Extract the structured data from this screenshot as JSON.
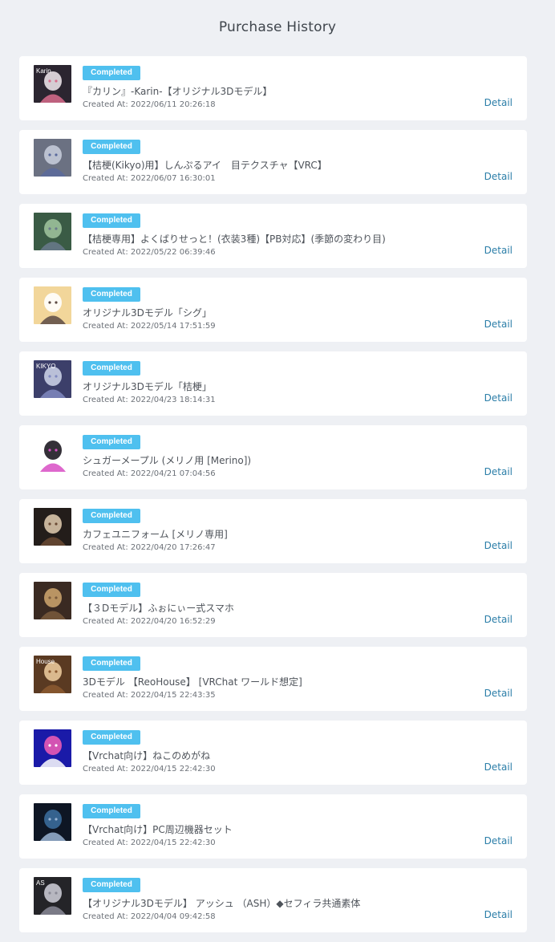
{
  "page": {
    "title": "Purchase History"
  },
  "purchases": [
    {
      "status": "Completed",
      "title": "『カリン』-Karin-【オリジナル3Dモデル】",
      "created": "Created At: 2022/06/11 20:26:18",
      "detail": "Detail",
      "thumb_text": "Karin",
      "thumb_icon": "karin-avatar-thumbnail",
      "colors": [
        "#2b2530",
        "#e8e0e6",
        "#d86c8c"
      ]
    },
    {
      "status": "Completed",
      "title": "【桔梗(Kikyo)用】しんぷるアイ　目テクスチャ【VRC】",
      "created": "Created At: 2022/06/07 16:30:01",
      "detail": "Detail",
      "thumb_text": "",
      "thumb_icon": "eye-texture-thumbnail",
      "colors": [
        "#6b7182",
        "#c4cad8",
        "#5a6a9c"
      ]
    },
    {
      "status": "Completed",
      "title": "【桔梗専用】よくばりせっと！(衣装3種)【PB対応】(季節の変わり目)",
      "created": "Created At: 2022/05/22 06:39:46",
      "detail": "Detail",
      "thumb_text": "",
      "thumb_icon": "outfit-set-thumbnail",
      "colors": [
        "#3a5b45",
        "#9cc09a",
        "#6a7a8c"
      ]
    },
    {
      "status": "Completed",
      "title": "オリジナル3Dモデル「シグ」",
      "created": "Created At: 2022/05/14 17:51:59",
      "detail": "Detail",
      "thumb_text": "",
      "thumb_icon": "sig-model-thumbnail",
      "colors": [
        "#f2d69a",
        "#ffffff",
        "#5c4a44"
      ]
    },
    {
      "status": "Completed",
      "title": "オリジナル3Dモデル「桔梗」",
      "created": "Created At: 2022/04/23 18:14:31",
      "detail": "Detail",
      "thumb_text": "KIKYO",
      "thumb_icon": "kikyo-model-thumbnail",
      "colors": [
        "#3c3f6a",
        "#c8cee4",
        "#8089c0"
      ]
    },
    {
      "status": "Completed",
      "title": "シュガーメープル (メリノ用 [Merino])",
      "created": "Created At: 2022/04/21 07:04:56",
      "detail": "Detail",
      "thumb_text": "",
      "thumb_icon": "sugar-maple-thumbnail",
      "colors": [
        "#ffffff",
        "#1e1a22",
        "#d84ec4"
      ]
    },
    {
      "status": "Completed",
      "title": "カフェユニフォーム [メリノ専用]",
      "created": "Created At: 2022/04/20 17:26:47",
      "detail": "Detail",
      "thumb_text": "",
      "thumb_icon": "cafe-uniform-thumbnail",
      "colors": [
        "#231d1a",
        "#d8c4a8",
        "#6a4a34"
      ]
    },
    {
      "status": "Completed",
      "title": "【３Dモデル】ふぉにぃー式スマホ",
      "created": "Created At: 2022/04/20 16:52:29",
      "detail": "Detail",
      "thumb_text": "",
      "thumb_icon": "smartphone-thumbnail",
      "colors": [
        "#3a2a22",
        "#c8a06a",
        "#7a5a3c"
      ]
    },
    {
      "status": "Completed",
      "title": "3Dモデル 【ReoHouse】 [VRChat ワールド想定]",
      "created": "Created At: 2022/04/15 22:43:35",
      "detail": "Detail",
      "thumb_text": "House",
      "thumb_icon": "reohouse-thumbnail",
      "colors": [
        "#5a3a22",
        "#e8c89a",
        "#8c5a30"
      ]
    },
    {
      "status": "Completed",
      "title": "【Vrchat向け】ねこのめがね",
      "created": "Created At: 2022/04/15 22:42:30",
      "detail": "Detail",
      "thumb_text": "",
      "thumb_icon": "cat-glasses-thumbnail",
      "colors": [
        "#1a1aa8",
        "#e85ab4",
        "#ffffff"
      ]
    },
    {
      "status": "Completed",
      "title": "【Vrchat向け】PC周辺機器セット",
      "created": "Created At: 2022/04/15 22:42:30",
      "detail": "Detail",
      "thumb_text": "",
      "thumb_icon": "pc-peripherals-thumbnail",
      "colors": [
        "#0e1624",
        "#3a6a9a",
        "#9ab4d4"
      ]
    },
    {
      "status": "Completed",
      "title": "【オリジナル3Dモデル】 アッシュ （ASH）◆セフィラ共通素体",
      "created": "Created At: 2022/04/04 09:42:58",
      "detail": "Detail",
      "thumb_text": "AS",
      "thumb_icon": "ash-model-thumbnail",
      "colors": [
        "#242428",
        "#c8c8d0",
        "#8a8a96"
      ]
    }
  ],
  "theme": {
    "background": "#eef0f4",
    "card": "#ffffff",
    "badge": "#4fc0ef",
    "link": "#2b7ea8"
  }
}
